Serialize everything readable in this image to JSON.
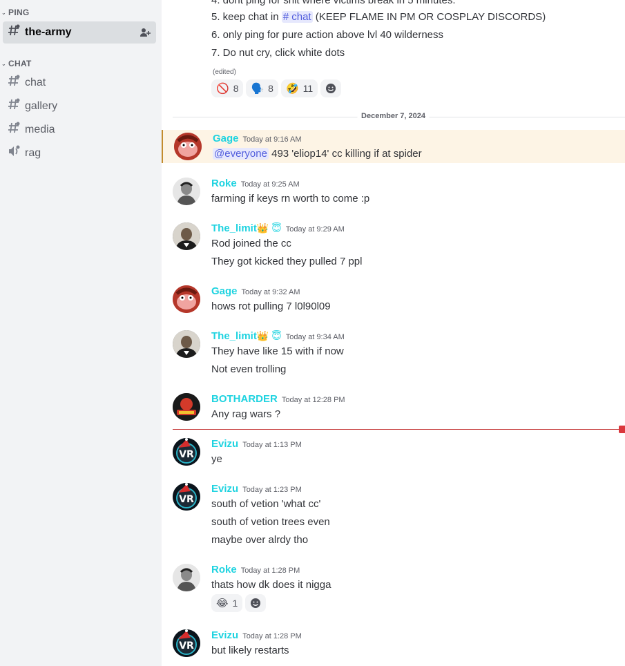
{
  "sidebar": {
    "categories": [
      "PING",
      "CHAT"
    ],
    "channels": [
      {
        "name": "the-army"
      },
      {
        "name": "chat"
      },
      {
        "name": "gallery"
      },
      {
        "name": "media"
      },
      {
        "name": "rag"
      }
    ]
  },
  "rules": {
    "line4": "4. dont ping for shit where victims break in 5 minutes.",
    "line5_pre": "5. keep chat in ",
    "line5_chan": "# chat",
    "line5_post": " (KEEP FLAME IN PM OR COSPLAY DISCORDS)",
    "line6": "6. only ping for pure action above lvl 40 wilderness",
    "line7": "7. Do nut cry, click white dots",
    "edited": "(edited)",
    "reactions": [
      {
        "emoji": "🚫",
        "count": "8"
      },
      {
        "emoji": "🗣️",
        "count": "8"
      },
      {
        "emoji": "🤣",
        "count": "11"
      }
    ]
  },
  "date_divider": "December 7, 2024",
  "messages": [
    {
      "author": "Gage",
      "time": "Today at 9:16 AM",
      "ping": "@everyone",
      "lines": [
        "493 'eliop14' cc killing if at spider"
      ]
    },
    {
      "author": "Roke",
      "time": "Today at 9:25 AM",
      "lines": [
        "farming if keys rn  worth to come :p"
      ]
    },
    {
      "author": "The_limit",
      "badges": "👑 😇",
      "time": "Today at 9:29 AM",
      "lines": [
        "Rod joined the cc",
        "They got kicked they pulled 7 ppl"
      ]
    },
    {
      "author": "Gage",
      "time": "Today at 9:32 AM",
      "lines": [
        "hows rot pulling 7 l0l90l09"
      ]
    },
    {
      "author": "The_limit",
      "badges": "👑 😇",
      "time": "Today at 9:34 AM",
      "lines": [
        "They have  like 15 with if now",
        "Not even trolling"
      ]
    },
    {
      "author": "BOTHARDER",
      "time": "Today at 12:28 PM",
      "lines": [
        "Any rag wars ?"
      ]
    },
    {
      "author": "Evizu",
      "time": "Today at 1:13 PM",
      "lines": [
        "ye"
      ]
    },
    {
      "author": "Evizu",
      "time": "Today at 1:23 PM",
      "lines": [
        "south of vetion 'what cc'",
        "south of vetion trees even",
        "maybe over alrdy tho"
      ]
    },
    {
      "author": "Roke",
      "time": "Today at 1:28 PM",
      "lines": [
        "thats how dk does it nigga"
      ],
      "reactions": [
        {
          "emoji": "😂",
          "count": "1"
        }
      ]
    },
    {
      "author": "Evizu",
      "time": "Today at 1:28 PM",
      "lines": [
        "but likely restarts"
      ]
    }
  ],
  "colors": {
    "username": "#1fd3e0",
    "mention_bg": "#e6e8fd",
    "mention_fg": "#505cdc",
    "new_line": "#da373c"
  }
}
